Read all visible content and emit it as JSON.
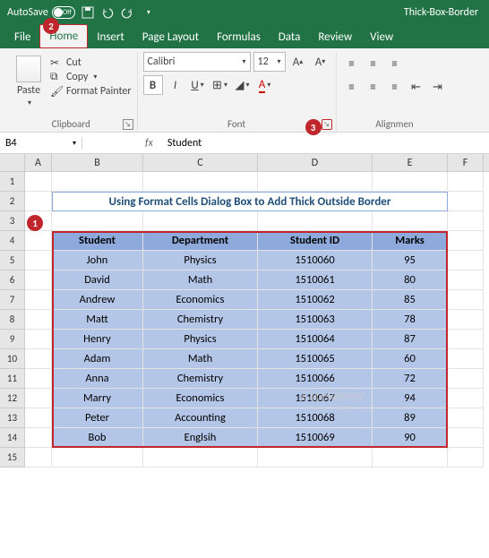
{
  "titlebar": {
    "autosave_label": "AutoSave",
    "autosave_state": "Off",
    "filename": "Thick-Box-Border"
  },
  "tabs": [
    "File",
    "Home",
    "Insert",
    "Page Layout",
    "Formulas",
    "Data",
    "Review",
    "View"
  ],
  "active_tab": "Home",
  "ribbon": {
    "clipboard": {
      "paste": "Paste",
      "cut": "Cut",
      "copy": "Copy",
      "format_painter": "Format Painter",
      "group": "Clipboard"
    },
    "font": {
      "name": "Calibri",
      "size": "12",
      "group": "Font"
    },
    "alignment": {
      "group": "Alignmen"
    }
  },
  "namebox": "B4",
  "formula": "Student",
  "columns": [
    "A",
    "B",
    "C",
    "D",
    "E",
    "F"
  ],
  "row_numbers": [
    "1",
    "2",
    "3",
    "4",
    "5",
    "6",
    "7",
    "8",
    "9",
    "10",
    "11",
    "12",
    "13",
    "14",
    "15"
  ],
  "sheet_title": "Using Format Cells Dialog Box to Add Thick Outside Border",
  "table": {
    "headers": [
      "Student",
      "Department",
      "Student ID",
      "Marks"
    ],
    "rows": [
      [
        "John",
        "Physics",
        "1510060",
        "95"
      ],
      [
        "David",
        "Math",
        "1510061",
        "80"
      ],
      [
        "Andrew",
        "Economics",
        "1510062",
        "85"
      ],
      [
        "Matt",
        "Chemistry",
        "1510063",
        "78"
      ],
      [
        "Henry",
        "Physics",
        "1510064",
        "87"
      ],
      [
        "Adam",
        "Math",
        "1510065",
        "60"
      ],
      [
        "Anna",
        "Chemistry",
        "1510066",
        "72"
      ],
      [
        "Marry",
        "Economics",
        "1510067",
        "94"
      ],
      [
        "Peter",
        "Accounting",
        "1510068",
        "89"
      ],
      [
        "Bob",
        "Englsih",
        "1510069",
        "90"
      ]
    ]
  },
  "callouts": {
    "c1": "1",
    "c2": "2",
    "c3": "3"
  },
  "watermark": "Exceldemy",
  "watermark_sub": "- EXCEL · DATA · BI -"
}
